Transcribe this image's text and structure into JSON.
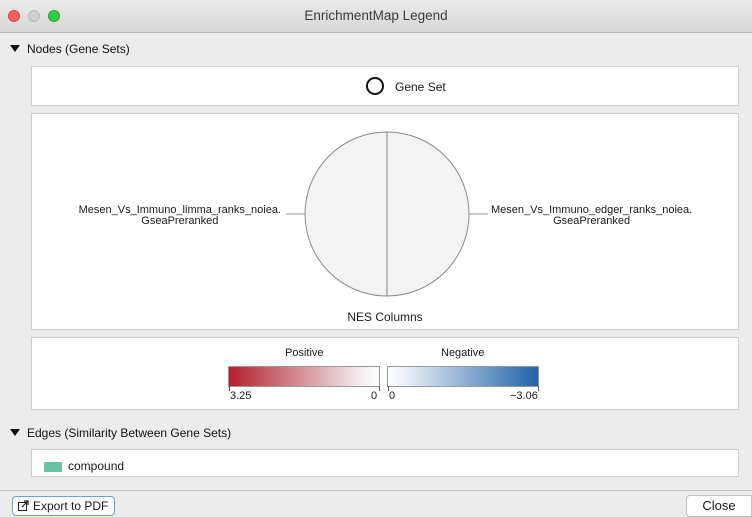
{
  "window": {
    "title": "EnrichmentMap Legend"
  },
  "nodes_section": {
    "header": "Nodes (Gene Sets)",
    "gene_set_label": "Gene Set",
    "chart": {
      "left_label_line1": "Mesen_Vs_Immuno_limma_ranks_noiea.",
      "left_label_line2": "GseaPreranked",
      "right_label_line1": "Mesen_Vs_Immuno_edger_ranks_noiea.",
      "right_label_line2": "GseaPreranked",
      "caption": "NES Columns",
      "fill_color": "#f3f3f3",
      "stroke_color": "#8a8a8a"
    },
    "color_scale": {
      "positive_title": "Positive",
      "negative_title": "Negative",
      "positive_max": "3.25",
      "positive_min": "0",
      "negative_min": "0",
      "negative_max": "−3.06",
      "positive_color": "#b41f2e",
      "negative_color": "#1f62a8"
    }
  },
  "edges_section": {
    "header": "Edges (Similarity Between Gene Sets)",
    "items": [
      {
        "label": "compound",
        "color": "#6cc3a3"
      }
    ]
  },
  "footer": {
    "export_label": "Export to PDF",
    "close_label": "Close"
  }
}
